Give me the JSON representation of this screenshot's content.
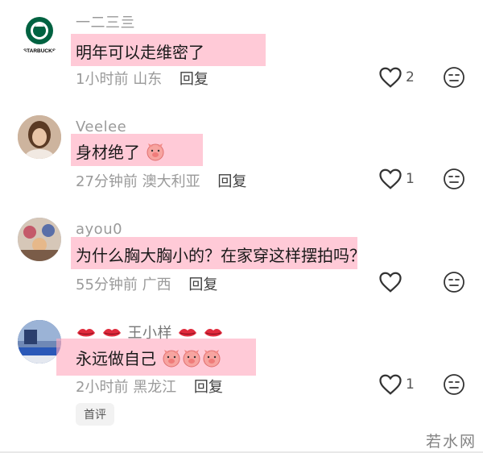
{
  "comments": [
    {
      "username": "一二三亖",
      "text": "明年可以走维密了",
      "time": "1小时前",
      "location": "山东",
      "reply_label": "回复",
      "likes": "2"
    },
    {
      "username": "Veelee",
      "text": "身材绝了",
      "time": "27分钟前",
      "location": "澳大利亚",
      "reply_label": "回复",
      "likes": "1"
    },
    {
      "username": "ayou0",
      "text": "为什么胸大胸小的？在家穿这样摆拍吗？",
      "time": "55分钟前",
      "location": "广西",
      "reply_label": "回复",
      "likes": ""
    },
    {
      "username": "王小样",
      "text": "永远做自己",
      "time": "2小时前",
      "location": "黑龙江",
      "reply_label": "回复",
      "likes": "1",
      "badge": "首评"
    }
  ],
  "avatar_logo_text": "STARBUCKS",
  "watermark": "若水网",
  "colors": {
    "highlight": "#ffaabe",
    "meta_text": "#9a9a9a",
    "reply_text": "#404040",
    "starbucks_green": "#006241"
  },
  "icons": [
    "heart-outline-icon",
    "meh-face-icon",
    "lips-emoji-icon",
    "pig-face-emoji-icon"
  ]
}
